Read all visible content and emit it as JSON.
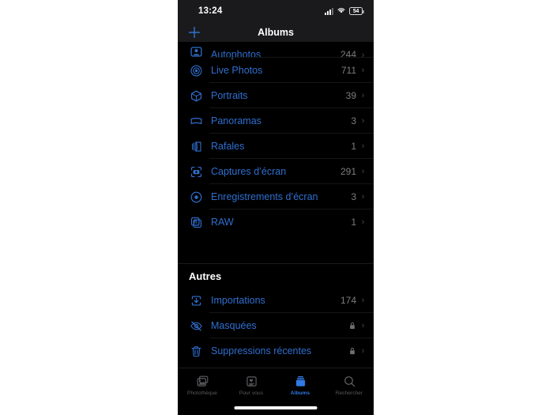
{
  "status_bar": {
    "time": "13:24",
    "cellular_icon": "cellular-signal-icon",
    "wifi_icon": "wifi-icon",
    "battery_level": "54",
    "battery_icon": "battery-icon"
  },
  "nav": {
    "title": "Albums",
    "add_icon": "plus-icon"
  },
  "albums": [
    {
      "icon": "autophotos-icon",
      "label": "Autophotos",
      "count": "244",
      "partial": true
    },
    {
      "icon": "live-photos-icon",
      "label": "Live Photos",
      "count": "711"
    },
    {
      "icon": "portraits-icon",
      "label": "Portraits",
      "count": "39"
    },
    {
      "icon": "panoramas-icon",
      "label": "Panoramas",
      "count": "3"
    },
    {
      "icon": "bursts-icon",
      "label": "Rafales",
      "count": "1"
    },
    {
      "icon": "screenshots-icon",
      "label": "Captures d’écran",
      "count": "291"
    },
    {
      "icon": "screen-recordings-icon",
      "label": "Enregistrements d’écran",
      "count": "3"
    },
    {
      "icon": "raw-icon",
      "label": "RAW",
      "count": "1"
    }
  ],
  "others_section": {
    "header": "Autres",
    "items": [
      {
        "icon": "import-icon",
        "label": "Importations",
        "count": "174",
        "locked": false
      },
      {
        "icon": "hidden-eye-icon",
        "label": "Masquées",
        "count": "",
        "locked": true
      },
      {
        "icon": "trash-icon",
        "label": "Suppressions récentes",
        "count": "",
        "locked": true
      }
    ]
  },
  "tab_bar": [
    {
      "icon": "photos-library-icon",
      "label": "Photothèque",
      "active": false
    },
    {
      "icon": "for-you-icon",
      "label": "Pour vous",
      "active": false
    },
    {
      "icon": "albums-stack-icon",
      "label": "Albums",
      "active": true
    },
    {
      "icon": "search-icon",
      "label": "Rechercher",
      "active": false
    }
  ],
  "colors": {
    "accent_blue": "#2f6fd0",
    "tab_active_blue": "#2f7ae5",
    "background": "#000000",
    "chrome": "#1a1a1c",
    "count_gray": "#7c7c80"
  }
}
